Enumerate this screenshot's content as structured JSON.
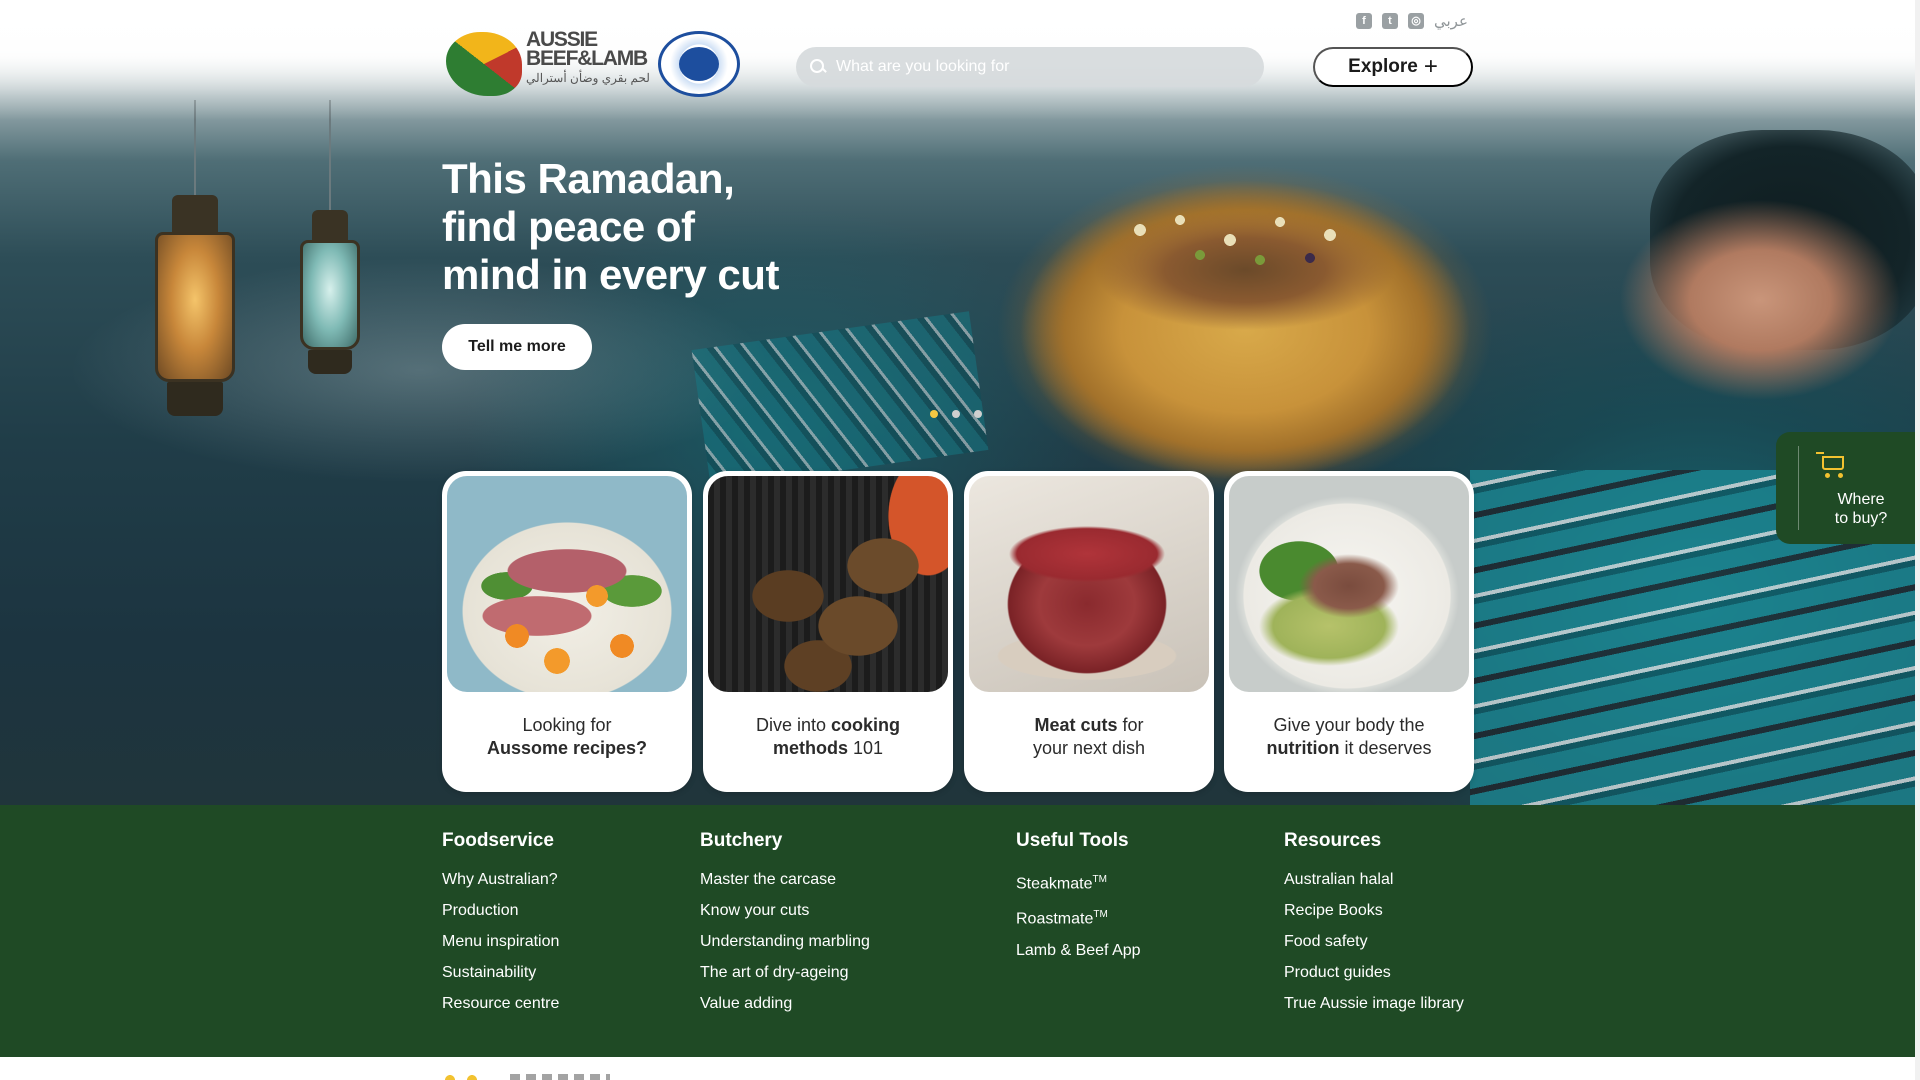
{
  "header": {
    "logo": {
      "line1": "AUSSIE",
      "line2": "BEEF&LAMB",
      "line3": "لحم بقري وضأن أسترالي",
      "seal_text": "حلال"
    },
    "search": {
      "placeholder": "What are you looking for"
    },
    "explore": {
      "label": "Explore",
      "icon": "plus-icon"
    },
    "social": [
      {
        "name": "facebook-icon",
        "glyph": "f"
      },
      {
        "name": "twitter-icon",
        "glyph": "t"
      },
      {
        "name": "instagram-icon",
        "glyph": "◎"
      }
    ],
    "language_link": "عربي"
  },
  "hero": {
    "title_lines": [
      "This Ramadan,",
      "find peace of",
      "mind in every cut"
    ],
    "cta_label": "Tell me more",
    "carousel": {
      "slides": 3,
      "active": 1
    }
  },
  "cards": [
    {
      "line1": "Looking for",
      "line2_bold": "Aussome recipes?",
      "line2_rest": "",
      "image": "salad-with-lamb"
    },
    {
      "line1_pre": "Dive into ",
      "line1_bold": "cooking",
      "line2_bold": "methods",
      "line2_rest": " 101",
      "image": "grilled-lamb"
    },
    {
      "line1_bold": "Meat cuts",
      "line1_rest": " for",
      "line2": "your next dish",
      "image": "raw-beef-fillet"
    },
    {
      "line1": "Give your body the",
      "line2_bold": "nutrition",
      "line2_rest": " it deserves",
      "image": "sliced-beef-bowl"
    }
  ],
  "where_to_buy": {
    "line1": "Where",
    "line2": "to buy?",
    "icon": "cart-icon"
  },
  "footer": {
    "columns": [
      {
        "heading": "Foodservice",
        "links": [
          "Why Australian?",
          "Production",
          "Menu inspiration",
          "Sustainability",
          "Resource centre"
        ]
      },
      {
        "heading": "Butchery",
        "links": [
          "Master the carcase",
          "Know your cuts",
          "Understanding marbling",
          "The art of dry-ageing",
          "Value adding"
        ]
      },
      {
        "heading": "Useful Tools",
        "links": [
          "Steakmate",
          "Roastmate",
          "Lamb & Beef App"
        ],
        "superscript": "TM"
      },
      {
        "heading": "Resources",
        "links": [
          "Australian halal",
          "Recipe Books",
          "Food safety",
          "Product guides",
          "True Aussie image library"
        ]
      }
    ]
  },
  "colors": {
    "footer_bg": "#1f4a25",
    "accent_yellow": "#f2c230",
    "white": "#ffffff"
  }
}
